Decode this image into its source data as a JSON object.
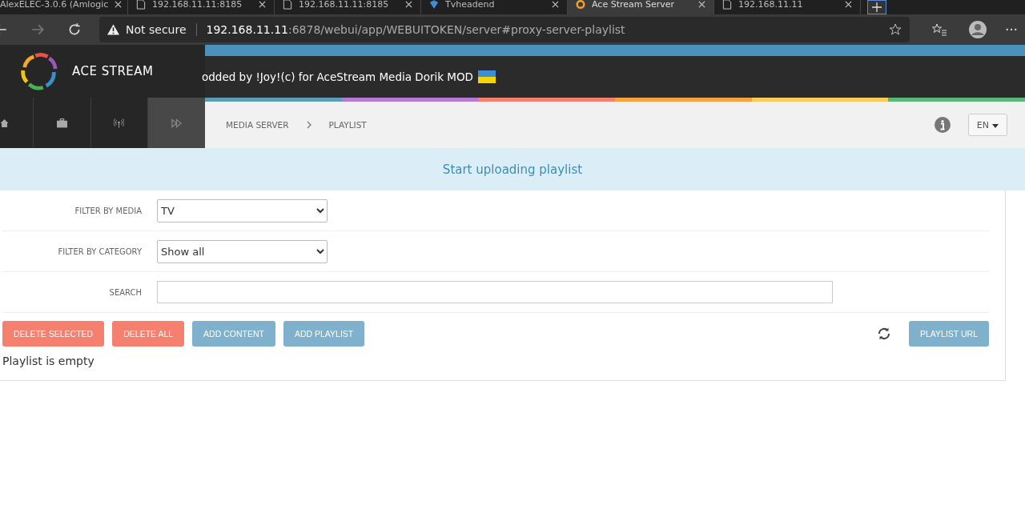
{
  "browser": {
    "tabs": [
      {
        "title": "AlexELEC-3.0.6 (Amlogic",
        "kind": "page",
        "selected": false
      },
      {
        "title": "192.168.11.11:8185",
        "kind": "doc",
        "selected": false
      },
      {
        "title": "192.168.11.11:8185",
        "kind": "doc",
        "selected": false
      },
      {
        "title": "Tvheadend",
        "kind": "tv",
        "selected": false
      },
      {
        "title": "Ace Stream Server",
        "kind": "ace",
        "selected": true
      },
      {
        "title": "192.168.11.11",
        "kind": "doc",
        "selected": false
      }
    ],
    "security": "Not secure",
    "url_host": "192.168.11.11",
    "url_rest": ":6878/webui/app/WEBUITOKEN/server#proxy-server-playlist"
  },
  "header": {
    "logo_text": "ACE STREAM",
    "marquee": "odded by !Joy!(c) for AceStream Media Dorik MOD"
  },
  "nav": [
    {
      "kind": "home",
      "selected": false
    },
    {
      "kind": "briefcase",
      "selected": false
    },
    {
      "kind": "antenna",
      "selected": false
    },
    {
      "kind": "forward",
      "selected": true
    }
  ],
  "breadcrumb": [
    "MEDIA SERVER",
    "PLAYLIST"
  ],
  "language": "EN",
  "banner": "Start uploading playlist",
  "filters": [
    {
      "label": "FILTER BY MEDIA",
      "kind": "select",
      "value": "TV"
    },
    {
      "label": "FILTER BY CATEGORY",
      "kind": "select",
      "value": "Show all"
    },
    {
      "label": "SEARCH",
      "kind": "text"
    }
  ],
  "actions": [
    {
      "label": "DELETE SELECTED",
      "kind": "danger"
    },
    {
      "label": "DELETE ALL",
      "kind": "danger"
    },
    {
      "label": "ADD CONTENT",
      "kind": "primary"
    },
    {
      "label": "ADD PLAYLIST",
      "kind": "primary"
    }
  ],
  "playlist_url": "PLAYLIST URL",
  "empty_message": "Playlist is empty"
}
